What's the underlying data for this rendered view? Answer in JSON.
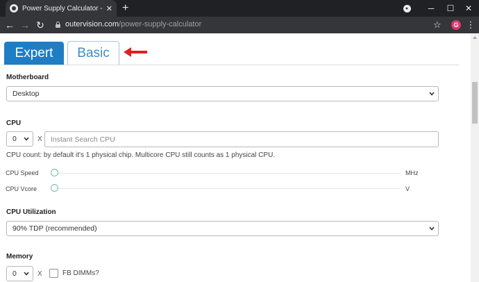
{
  "browser": {
    "tab_title": "Power Supply Calculator - PSU C",
    "tab_close": "✕",
    "new_tab": "+",
    "url_host": "outervision.com",
    "url_path": "/power-supply-calculator",
    "avatar_letter": "G",
    "icons": [
      "back-arrow-icon",
      "forward-arrow-icon",
      "reload-icon",
      "lock-icon",
      "star-icon",
      "kebab-menu-icon",
      "minimize-icon",
      "maximize-icon",
      "close-icon"
    ]
  },
  "tabs": {
    "expert": "Expert",
    "basic": "Basic"
  },
  "motherboard": {
    "label": "Motherboard",
    "value": "Desktop"
  },
  "cpu": {
    "label": "CPU",
    "count_value": "0",
    "times": "X",
    "search_placeholder": "Instant Search CPU",
    "hint": "CPU count: by default it's 1 physical chip. Multicore CPU still counts as 1 physical CPU.",
    "speed_label": "CPU Speed",
    "speed_unit": "MHz",
    "vcore_label": "CPU Vcore",
    "vcore_unit": "V"
  },
  "cpu_utilization": {
    "label": "CPU Utilization",
    "value": "90% TDP (recommended)"
  },
  "memory": {
    "label": "Memory",
    "count_value": "0",
    "times": "X",
    "fb_dimms_label": "FB DIMMs?",
    "fb_dimms_checked": false
  },
  "colors": {
    "expert_tab": "#1f7dc4",
    "basic_tab_text": "#3c8ccb",
    "annotation_arrow": "#e02020",
    "slider_handle": "#74b9b1"
  }
}
